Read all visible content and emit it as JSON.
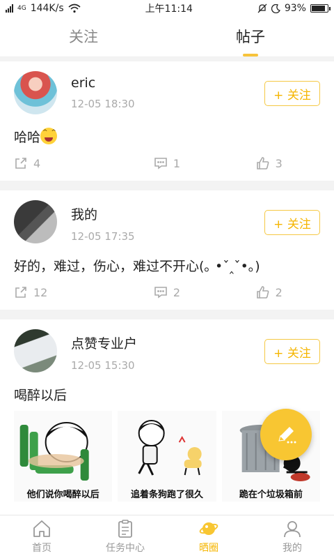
{
  "status_bar": {
    "network": "4G",
    "speed": "144K/s",
    "time": "上午11:14",
    "battery": "93%"
  },
  "tabs": [
    {
      "label": "关注",
      "active": false
    },
    {
      "label": "帖子",
      "active": true
    }
  ],
  "follow_label": "+ 关注",
  "posts": [
    {
      "username": "eric",
      "time": "12-05 18:30",
      "content": "哈哈",
      "emoji": "grin-emoji",
      "shares": "4",
      "comments": "1",
      "likes": "3"
    },
    {
      "username": "我的",
      "time": "12-05 17:35",
      "content": "好的，难过，伤心，难过不开心(｡ •ˇ‸ˇ•｡)",
      "shares": "12",
      "comments": "2",
      "likes": "2"
    },
    {
      "username": "点赞专业户",
      "time": "12-05 15:30",
      "content": "喝醉以后",
      "images": [
        {
          "caption": "他们说你喝醉以后"
        },
        {
          "caption": "追着条狗跑了很久"
        },
        {
          "caption": "跪在个垃圾箱前"
        }
      ]
    }
  ],
  "bottom_nav": [
    {
      "label": "首页",
      "icon": "home-icon",
      "active": false
    },
    {
      "label": "任务中心",
      "icon": "clipboard-icon",
      "active": false
    },
    {
      "label": "晒圈",
      "icon": "planet-icon",
      "active": true
    },
    {
      "label": "我的",
      "icon": "user-icon",
      "active": false
    }
  ],
  "colors": {
    "accent": "#f5b500",
    "fab": "#f8c632"
  }
}
